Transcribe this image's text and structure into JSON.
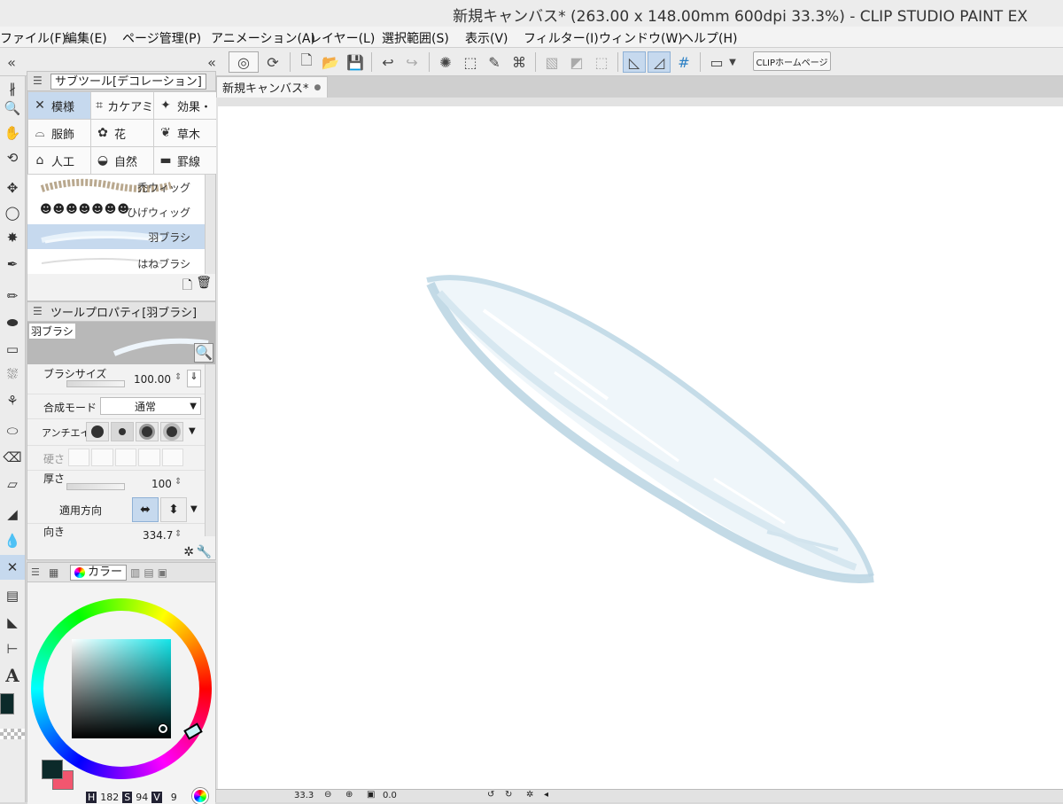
{
  "window": {
    "title": "新規キャンバス* (263.00 x 148.00mm 600dpi 33.3%)  - CLIP STUDIO PAINT EX"
  },
  "menu": [
    "ファイル(F)",
    "編集(E)",
    "ページ管理(P)",
    "アニメーション(A)",
    "レイヤー(L)",
    "選択範囲(S)",
    "表示(V)",
    "フィルター(I)",
    "ウィンドウ(W)",
    "ヘルプ(H)"
  ],
  "toolbar": {
    "home_label": "CLIPホームページ"
  },
  "subtool_panel": {
    "title": "サブツール[デコレーション]",
    "groups": [
      {
        "label": "模様",
        "icon": "pattern-icon"
      },
      {
        "label": "カケアミ",
        "icon": "crosshatch-icon"
      },
      {
        "label": "効果・",
        "icon": "sparkle-icon"
      },
      {
        "label": "服飾",
        "icon": "hat-icon"
      },
      {
        "label": "花",
        "icon": "flower-icon"
      },
      {
        "label": "草木",
        "icon": "plant-icon"
      },
      {
        "label": "人工",
        "icon": "house-icon"
      },
      {
        "label": "自然",
        "icon": "rock-icon"
      },
      {
        "label": "罫線",
        "icon": "line-icon"
      }
    ],
    "brushes": [
      {
        "label": "禿ウィッグ"
      },
      {
        "label": "ひげウィッグ"
      },
      {
        "label": "羽ブラシ",
        "selected": true
      },
      {
        "label": "はねブラシ"
      }
    ]
  },
  "tool_property": {
    "title": "ツールプロパティ[羽ブラシ]",
    "preview_label": "羽ブラシ",
    "brush_size_label": "ブラシサイズ",
    "brush_size_value": "100.00",
    "blend_mode_label": "合成モード",
    "blend_mode_value": "通常",
    "antialias_label": "アンチエイリ",
    "hardness_label": "硬さ",
    "thickness_label": "厚さ",
    "thickness_value": "100",
    "apply_dir_label": "適用方向",
    "direction_label": "向き",
    "direction_value": "334.7"
  },
  "color_panel": {
    "tab_label": "カラー",
    "readout": {
      "h_label": "H",
      "h": "182",
      "s_label": "S",
      "s": "94",
      "v_label": "V",
      "v": "9"
    },
    "main_color": "#0c2a2a",
    "sub_color": "#f2566f"
  },
  "document": {
    "tab_label": "新規キャンバス*"
  },
  "status": {
    "zoom": "33.3",
    "angle": "0.0"
  }
}
